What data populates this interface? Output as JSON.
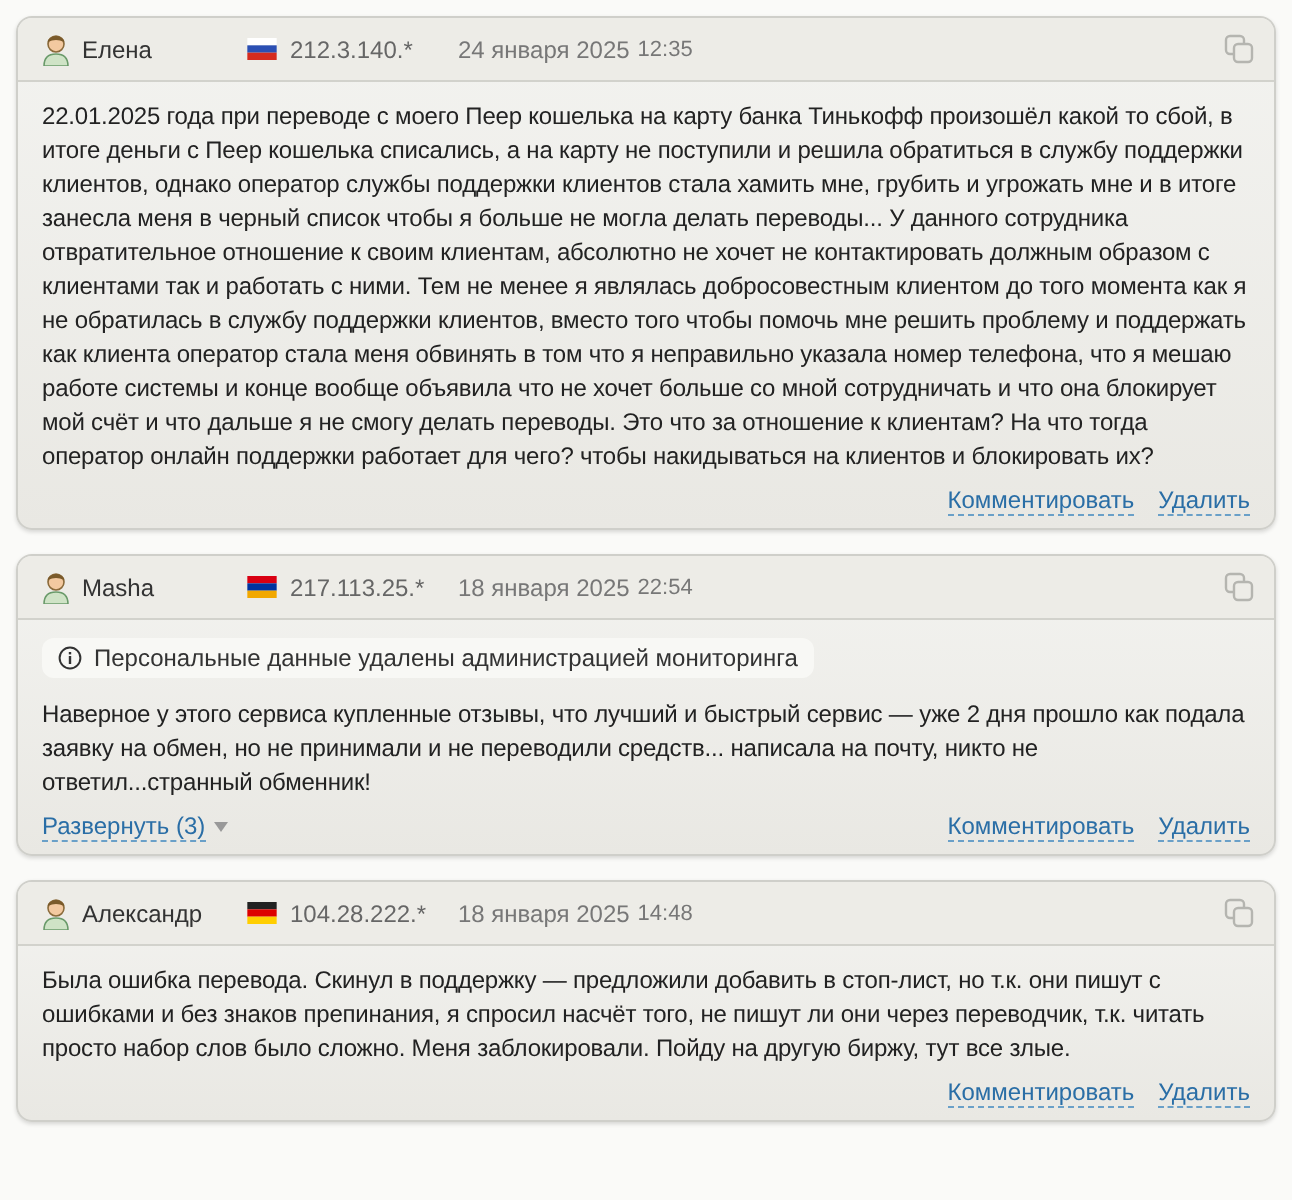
{
  "reviews": [
    {
      "author": "Елена",
      "kind": "ru",
      "ip": "212.3.140.*",
      "date": "24 января 2025",
      "time": "12:35",
      "text": "22.01.2025 года при переводе с моего Пеер кошелька на карту банка Тинькофф произошёл какой то сбой, в итоге деньги с Пеер кошелька списались, а на карту не поступили и решила обратиться в службу поддержки клиентов, однако оператор службы поддержки клиентов стала хамить мне, грубить и угрожать мне и в итоге занесла меня в черный список чтобы я больше не могла делать переводы... У данного сотрудника отвратительное отношение к своим клиентам, абсолютно не хочет не контактировать должным образом с клиентами так и работать с ними. Тем не менее я являлась добросовестным клиентом до того момента как я не обратилась в службу поддержки клиентов, вместо того чтобы помочь мне решить проблему и поддержать как клиента оператор стала меня обвинять в том что я неправильно указала номер телефона, что я мешаю работе системы и конце вообще объявила что не хочет больше со мной сотрудничать и что она блокирует мой счёт и что дальше я не смогу делать переводы. Это что за отношение к клиентам? На что тогда оператор онлайн поддержки работает для чего? чтобы накидываться на клиентов и блокировать их?",
      "actions": [
        "Комментировать",
        "Удалить"
      ]
    },
    {
      "author": "Masha",
      "kind": "am",
      "ip": "217.113.25.*",
      "date": "18 января 2025",
      "time": "22:54",
      "notice": "Персональные данные удалены администрацией мониторинга",
      "text": "Наверное у этого сервиса купленные отзывы, что лучший и быстрый сервис — уже 2 дня прошло как подала заявку на обмен, но не принимали и не переводили средств... написала на почту, никто не ответил...странный обменник!",
      "expand": "Развернуть (3)",
      "actions": [
        "Комментировать",
        "Удалить"
      ]
    },
    {
      "author": "Александр",
      "kind": "de",
      "ip": "104.28.222.*",
      "date": "18 января 2025",
      "time": "14:48",
      "text": "Была ошибка перевода. Скинул в поддержку — предложили добавить в стоп-лист, но т.к. они пишут с ошибками и без знаков препинания, я спросил насчёт того, не пишут ли они через переводчик, т.к. читать просто набор слов было сложно. Меня заблокировали. Пойду на другую биржу, тут все злые.",
      "actions": [
        "Комментировать",
        "Удалить"
      ]
    }
  ]
}
